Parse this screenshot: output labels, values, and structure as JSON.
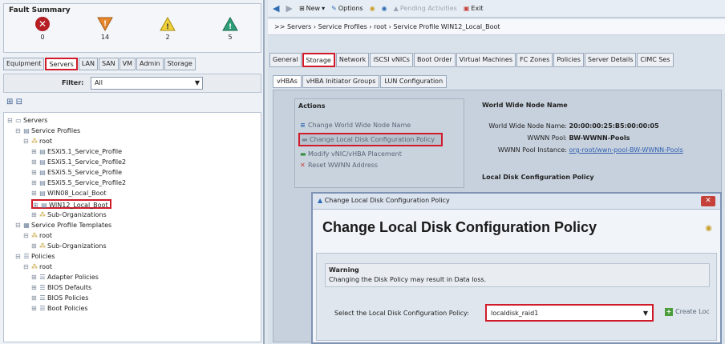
{
  "fault_summary": {
    "title": "Fault Summary",
    "counts": [
      {
        "icon": "critical-icon",
        "value": "0"
      },
      {
        "icon": "major-icon",
        "value": "14"
      },
      {
        "icon": "minor-icon",
        "value": "2"
      },
      {
        "icon": "warning-icon",
        "value": "5"
      }
    ]
  },
  "left_tabs": [
    "Equipment",
    "Servers",
    "LAN",
    "SAN",
    "VM",
    "Admin",
    "Storage"
  ],
  "filter": {
    "label": "Filter:",
    "value": "All"
  },
  "tree": [
    "Servers",
    "Service Profiles",
    "root",
    "ESXi5.1_Service_Profile",
    "ESXi5.1_Service_Profile2",
    "ESXi5.5_Service_Profile",
    "ESXi5.5_Service_Profile2",
    "WIN08_Local_Boot",
    "WIN12_Local_Boot",
    "Sub-Organizations",
    "Service Profile Templates",
    "root",
    "Sub-Organizations",
    "Policies",
    "root",
    "Adapter Policies",
    "BIOS Defaults",
    "BIOS Policies",
    "Boot Policies"
  ],
  "toolbar": {
    "new": "New",
    "options": "Options",
    "pending": "Pending Activities",
    "exit": "Exit"
  },
  "breadcrumb": ">> Servers › Service Profiles › root › Service Profile WIN12_Local_Boot",
  "right_tabs": [
    "General",
    "Storage",
    "Network",
    "iSCSI vNICs",
    "Boot Order",
    "Virtual Machines",
    "FC Zones",
    "Policies",
    "Server Details",
    "CIMC Ses"
  ],
  "sub_tabs": [
    "vHBAs",
    "vHBA Initiator Groups",
    "LUN Configuration"
  ],
  "actions": {
    "title": "Actions",
    "items": [
      "Change World Wide Node Name",
      "Change Local Disk Configuration Policy",
      "Modify vNIC/vHBA Placement",
      "Reset WWNN Address"
    ]
  },
  "wwnn": {
    "title": "World Wide Node Name",
    "node_label": "World Wide Node Name:",
    "node_value": "20:00:00:25:B5:00:00:05",
    "pool_label": "WWNN Pool:",
    "pool_value": "BW-WWNN-Pools",
    "instance_label": "WWNN Pool Instance:",
    "instance_value": "org-root/wwn-pool-BW-WWNN-Pools"
  },
  "local_disk_title": "Local Disk Configuration Policy",
  "dialog": {
    "bar_title": "Change Local Disk Configuration Policy",
    "heading": "Change Local Disk Configuration Policy",
    "warning_title": "Warning",
    "warning_text": "Changing the Disk Policy may result in Data loss.",
    "select_label": "Select the Local Disk Configuration Policy:",
    "select_value": "localdisk_raid1",
    "create_label": "Create Loc"
  }
}
